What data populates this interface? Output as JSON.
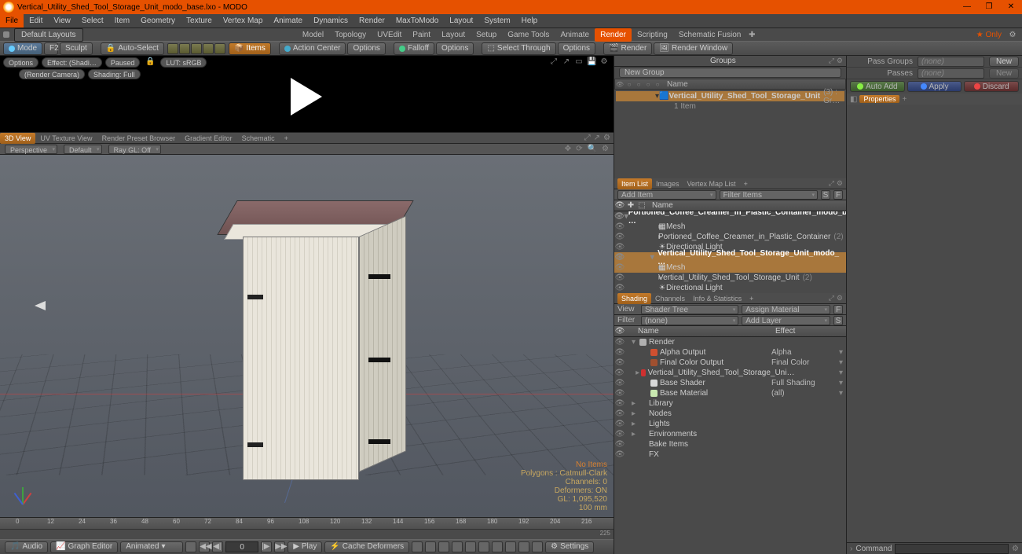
{
  "titlebar": {
    "title": "Vertical_Utility_Shed_Tool_Storage_Unit_modo_base.lxo - MODO"
  },
  "menu": [
    "File",
    "Edit",
    "View",
    "Select",
    "Item",
    "Geometry",
    "Texture",
    "Vertex Map",
    "Animate",
    "Dynamics",
    "Render",
    "MaxToModo",
    "Layout",
    "System",
    "Help"
  ],
  "layoutsDropdown": "Default Layouts",
  "layoutTabs": [
    "Model",
    "Topology",
    "UVEdit",
    "Paint",
    "Layout",
    "Setup",
    "Game Tools",
    "Animate",
    "Render",
    "Scripting",
    "Schematic Fusion"
  ],
  "layoutActive": "Render",
  "onlyLabel": "Only",
  "toolbar": {
    "modeBtn": "Mode",
    "sculpt": "Sculpt",
    "autoSelect": "Auto-Select",
    "items": "Items",
    "actionCenter": "Action Center",
    "options1": "Options",
    "falloff": "Falloff",
    "options2": "Options",
    "selectThrough": "Select Through",
    "options3": "Options",
    "renderBtn": "Render",
    "renderWindow": "Render Window"
  },
  "renderStrip": {
    "pills": [
      "Options",
      "Effect: (Shadi…",
      "Paused",
      "LUT: sRGB"
    ],
    "pills2": [
      "(Render Camera)",
      "Shading: Full"
    ]
  },
  "viewTabs": [
    "3D View",
    "UV Texture View",
    "Render Preset Browser",
    "Gradient Editor",
    "Schematic"
  ],
  "viewTabActive": "3D View",
  "viewOpts": {
    "persp": "Perspective",
    "def": "Default",
    "ray": "Ray GL: Off"
  },
  "vpstats": {
    "noitems": "No Items",
    "polygons": "Polygons : Catmull-Clark",
    "channels": "Channels: 0",
    "deformers": "Deformers: ON",
    "gl": "GL: 1,095,520",
    "unit": "100 mm"
  },
  "timeline": {
    "ticks": [
      "0",
      "12",
      "24",
      "36",
      "48",
      "60",
      "72",
      "84",
      "96",
      "108",
      "120",
      "132",
      "144",
      "156",
      "168",
      "180",
      "192",
      "204",
      "216"
    ],
    "end": "225"
  },
  "transport": {
    "audio": "Audio",
    "graphEditor": "Graph Editor",
    "animated": "Animated",
    "frame": "0",
    "play": "Play",
    "cacheDeformers": "Cache Deformers",
    "settings": "Settings"
  },
  "groups": {
    "title": "Groups",
    "newGroup": "New Group",
    "nameHdr": "Name",
    "item": "Vertical_Utility_Shed_Tool_Storage_Unit",
    "itemSuffix": "(3) : Gr…",
    "subCount": "1 Item"
  },
  "itemListTabs": [
    "Item List",
    "Images",
    "Vertex Map List"
  ],
  "itemListSub": {
    "addItem": "Add Item",
    "filterItems": "Filter Items",
    "s": "S",
    "f": "F"
  },
  "itemListHdr": "Name",
  "itemTree": [
    {
      "depth": 0,
      "bold": true,
      "exp": "▾",
      "text": "Portioned_Coffee_Creamer_in_Plastic_Container_modo_b …"
    },
    {
      "depth": 1,
      "exp": "▸",
      "icon": "mesh",
      "text": "Mesh"
    },
    {
      "depth": 1,
      "exp": "▸",
      "text": "Portioned_Coffee_Creamer_in_Plastic_Container",
      "suffix": "(2)"
    },
    {
      "depth": 1,
      "icon": "light",
      "text": "Directional Light"
    },
    {
      "depth": 0,
      "bold": true,
      "sel": true,
      "exp": "▾",
      "text": "Vertical_Utility_Shed_Tool_Storage_Unit_modo_ …"
    },
    {
      "depth": 1,
      "sel": true,
      "exp": "▸",
      "icon": "mesh",
      "text": "Mesh"
    },
    {
      "depth": 1,
      "exp": "▸",
      "text": "Vertical_Utility_Shed_Tool_Storage_Unit",
      "suffix": "(2)"
    },
    {
      "depth": 1,
      "icon": "light",
      "text": "Directional Light"
    }
  ],
  "shadingTabs": [
    "Shading",
    "Channels",
    "Info & Statistics"
  ],
  "shadingView": {
    "viewLabel": "View",
    "viewVal": "Shader Tree",
    "assign": "Assign Material",
    "f": "F",
    "filterLabel": "Filter",
    "filterVal": "(none)",
    "addLayer": "Add Layer",
    "s": "S"
  },
  "shadingHdr": {
    "name": "Name",
    "effect": "Effect"
  },
  "shaderTree": [
    {
      "depth": 0,
      "exp": "▾",
      "sw": "#b0b0b0",
      "text": "Render"
    },
    {
      "depth": 1,
      "sw": "#d05030",
      "text": "Alpha Output",
      "effect": "Alpha",
      "dd": true
    },
    {
      "depth": 1,
      "sw": "#a05030",
      "text": "Final Color Output",
      "effect": "Final Color",
      "dd": true
    },
    {
      "depth": 1,
      "exp": "▸",
      "sw": "#d03030",
      "text": "Vertical_Utility_Shed_Tool_Storage_Uni…",
      "dd": true
    },
    {
      "depth": 1,
      "sw": "#d8d8d8",
      "text": "Base Shader",
      "effect": "Full Shading",
      "dd": true
    },
    {
      "depth": 1,
      "sw": "#c8e8b0",
      "text": "Base Material",
      "effect": "(all)",
      "dd": true
    },
    {
      "depth": 0,
      "exp": "▸",
      "text": "Library"
    },
    {
      "depth": 0,
      "exp": "▸",
      "text": "Nodes"
    },
    {
      "depth": 0,
      "exp": "▸",
      "text": "Lights"
    },
    {
      "depth": 0,
      "exp": "▸",
      "text": "Environments"
    },
    {
      "depth": 0,
      "text": "Bake Items"
    },
    {
      "depth": 0,
      "icon": "fx",
      "text": "FX"
    }
  ],
  "rightCol": {
    "passGroupsLabel": "Pass Groups",
    "passGroupsVal": "(none)",
    "newBtn": "New",
    "passesLabel": "Passes",
    "passesVal": "(none)",
    "autoAdd": "Auto Add",
    "apply": "Apply",
    "discard": "Discard",
    "properties": "Properties",
    "command": "Command"
  }
}
